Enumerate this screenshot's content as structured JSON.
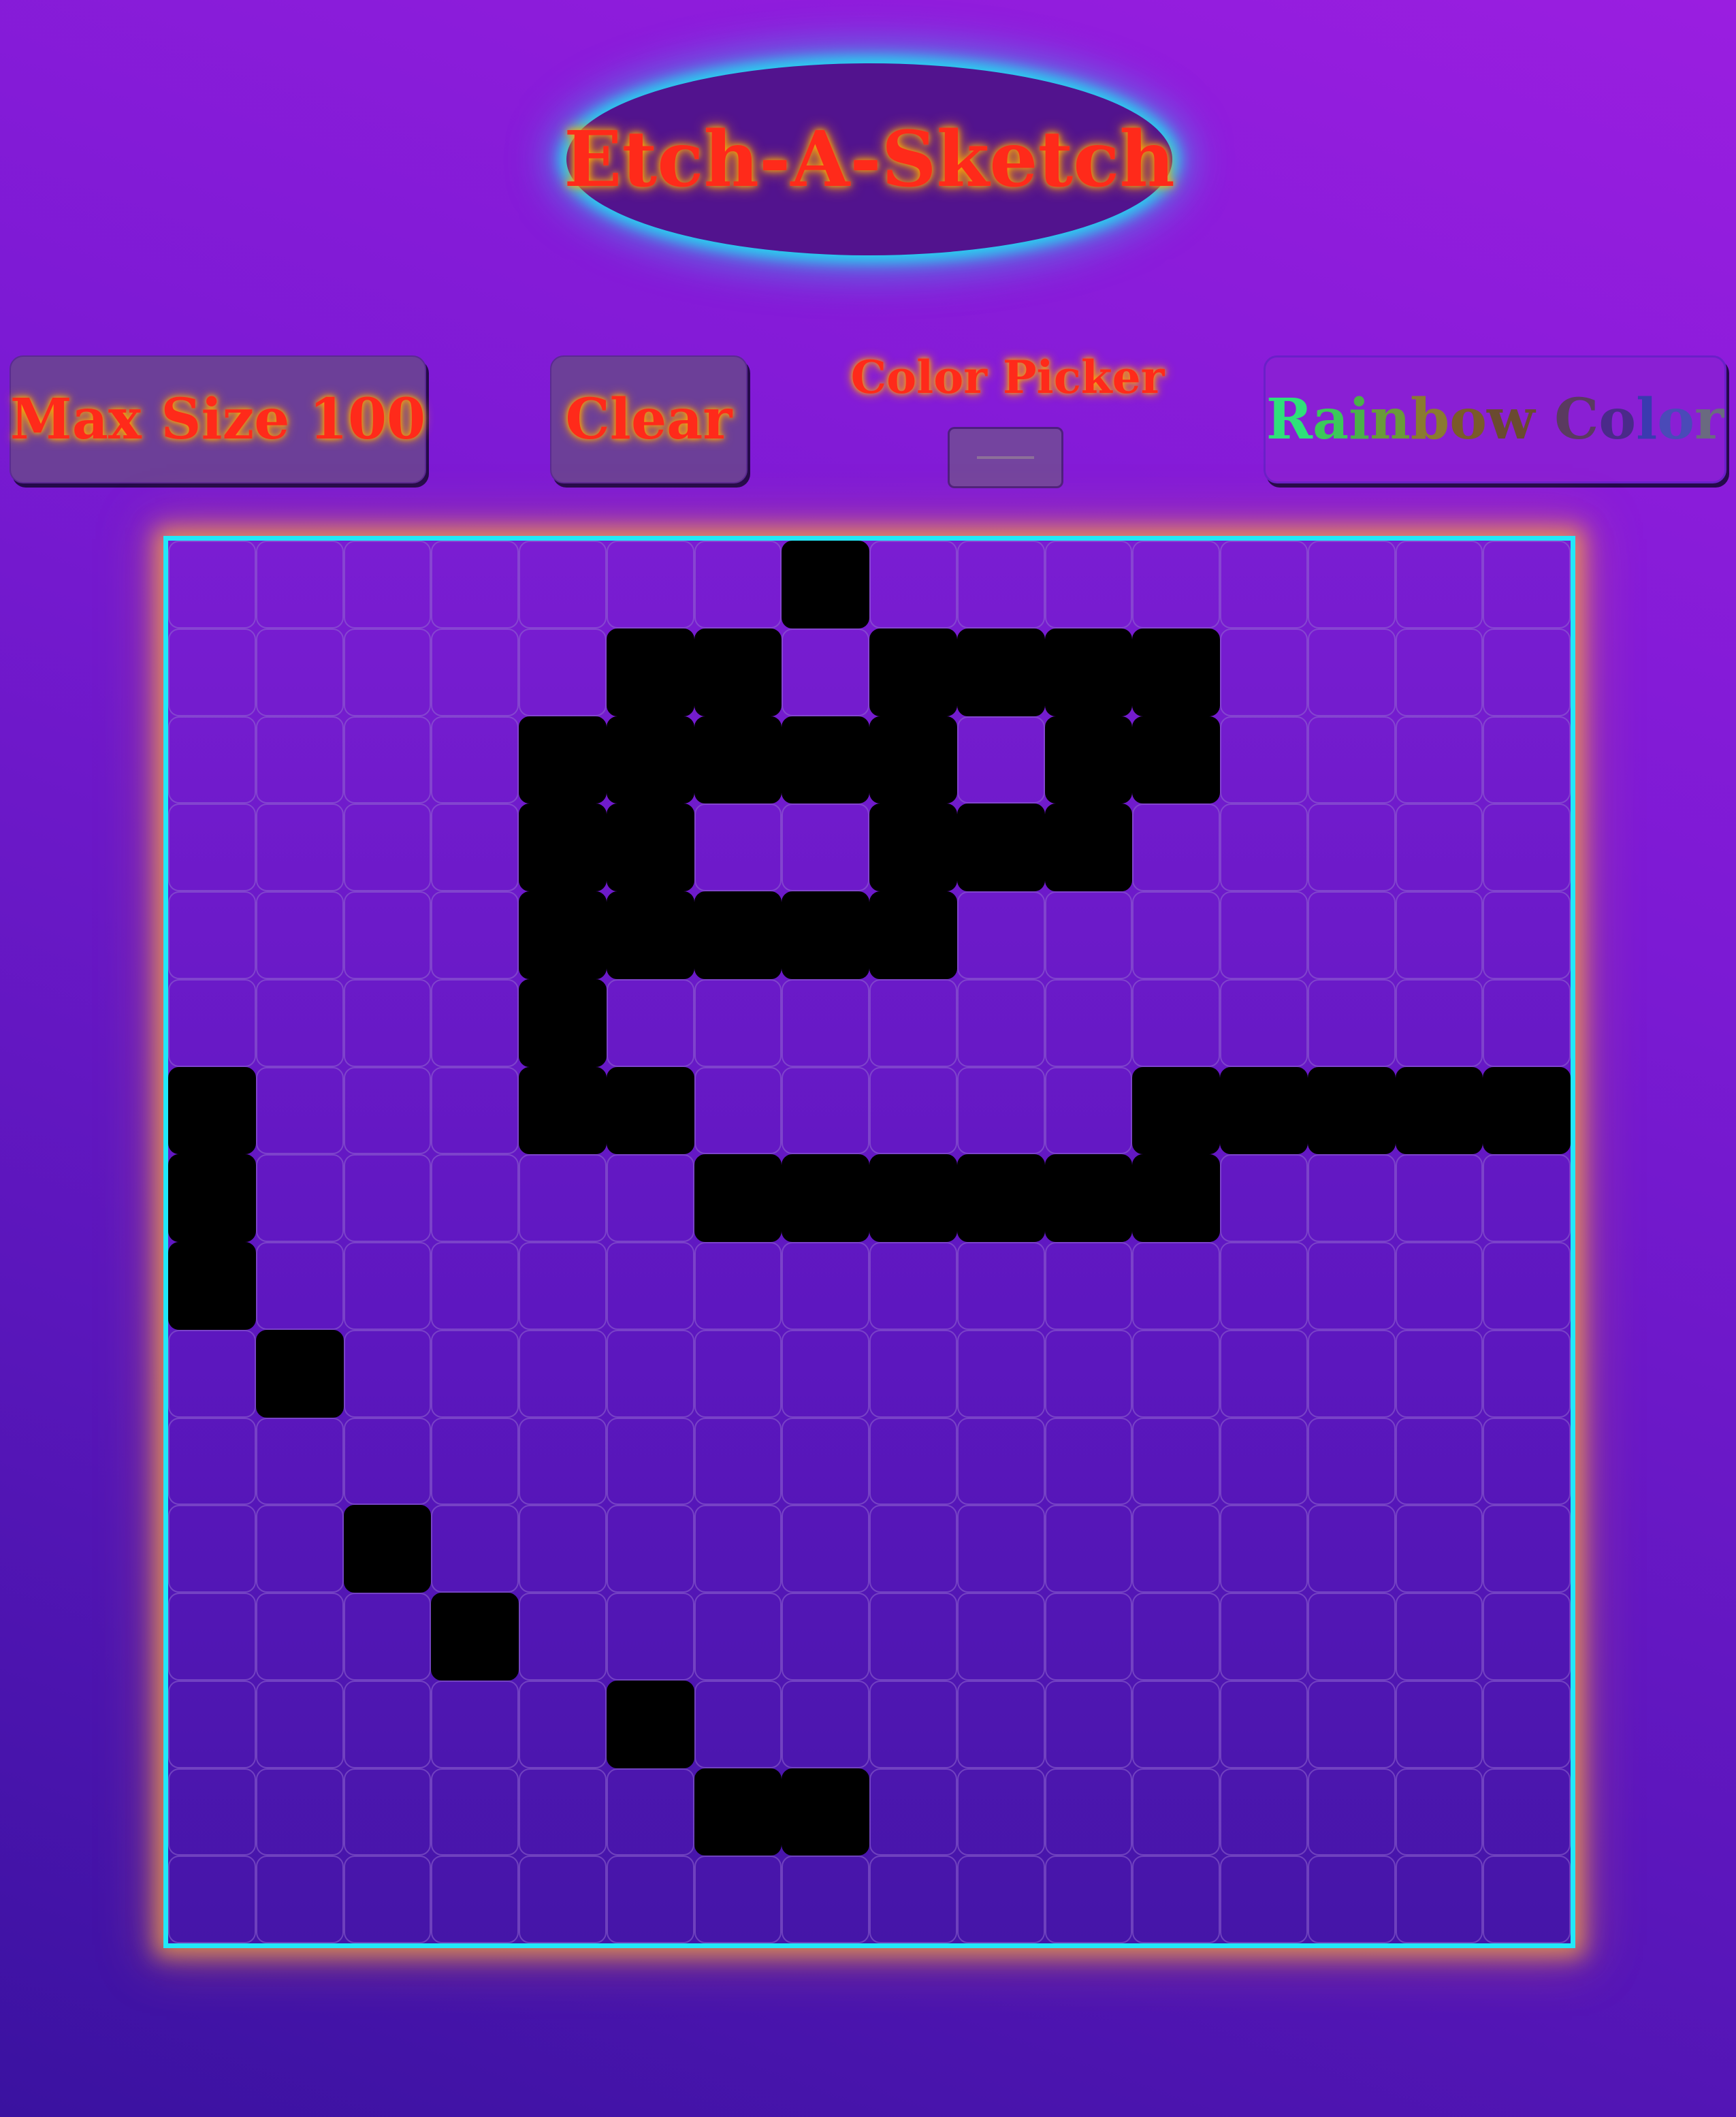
{
  "header": {
    "title": "Etch-A-Sketch"
  },
  "controls": {
    "max_size_label": "Max Size 100",
    "clear_label": "Clear",
    "color_picker_label": "Color Picker",
    "color_picker_value": "#74449f",
    "rainbow_label": "Rainbow Color",
    "rainbow_colors": [
      "#2fe07a",
      "#3cc85a",
      "#4bb04a",
      "#6a9a3a",
      "#8a7a30",
      "#7a5a2a",
      "#6a4a30",
      "#5a3a60",
      "#4a2a8a",
      "#3a3ab0",
      "#4a4ab8",
      "#6a6a80",
      "#8a7a50"
    ]
  },
  "grid": {
    "size": 16,
    "fill_color": "#000000",
    "filled_cells": [
      [
        0,
        7
      ],
      [
        1,
        5
      ],
      [
        1,
        6
      ],
      [
        1,
        8
      ],
      [
        1,
        9
      ],
      [
        1,
        10
      ],
      [
        1,
        11
      ],
      [
        2,
        4
      ],
      [
        2,
        5
      ],
      [
        2,
        6
      ],
      [
        2,
        7
      ],
      [
        2,
        8
      ],
      [
        2,
        10
      ],
      [
        2,
        11
      ],
      [
        3,
        4
      ],
      [
        3,
        5
      ],
      [
        3,
        8
      ],
      [
        3,
        9
      ],
      [
        3,
        10
      ],
      [
        4,
        4
      ],
      [
        4,
        5
      ],
      [
        4,
        6
      ],
      [
        4,
        7
      ],
      [
        4,
        8
      ],
      [
        5,
        4
      ],
      [
        6,
        0
      ],
      [
        6,
        4
      ],
      [
        6,
        5
      ],
      [
        6,
        11
      ],
      [
        6,
        12
      ],
      [
        6,
        13
      ],
      [
        6,
        14
      ],
      [
        6,
        15
      ],
      [
        7,
        0
      ],
      [
        7,
        6
      ],
      [
        7,
        7
      ],
      [
        7,
        8
      ],
      [
        7,
        9
      ],
      [
        7,
        10
      ],
      [
        7,
        11
      ],
      [
        8,
        0
      ],
      [
        9,
        1
      ],
      [
        11,
        2
      ],
      [
        12,
        3
      ],
      [
        13,
        5
      ],
      [
        14,
        6
      ],
      [
        14,
        7
      ]
    ]
  }
}
